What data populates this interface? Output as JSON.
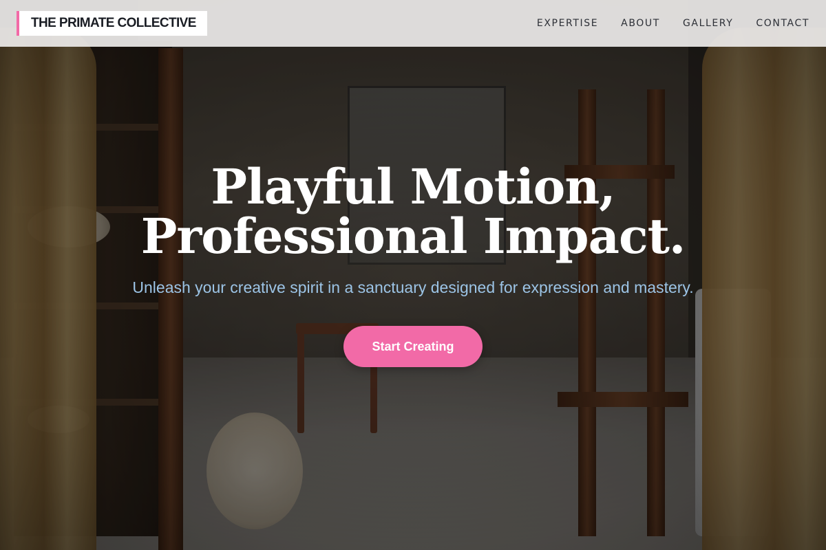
{
  "site": {
    "logo_text": "THE PRIMATE COLLECTIVE",
    "accent_color": "#f26aa7"
  },
  "nav": {
    "items": [
      {
        "label": "EXPERTISE"
      },
      {
        "label": "ABOUT"
      },
      {
        "label": "GALLERY"
      },
      {
        "label": "CONTACT"
      }
    ]
  },
  "hero": {
    "headline_line1": "Playful Motion,",
    "headline_line2": "Professional Impact.",
    "subtitle": "Unleash your creative spirit in a sanctuary designed for expression and mastery.",
    "cta_label": "Start Creating",
    "background_image": "art studio workshop with easels, shelves, chairs and curtains"
  }
}
